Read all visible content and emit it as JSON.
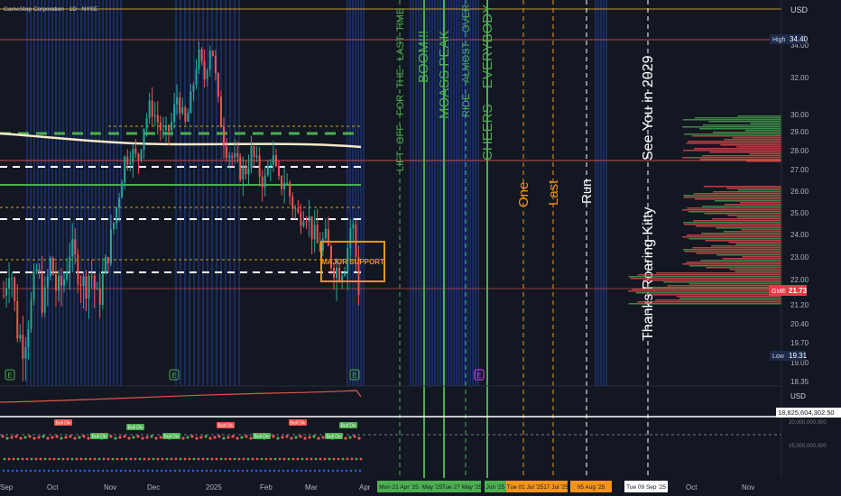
{
  "header": {
    "title": "GameStop Corporation · 1D · NYSE",
    "currency": "USD",
    "sub_currency": "USD",
    "sub_value": "18,825,604,302.50"
  },
  "price_axis": {
    "ticks": [
      "34.00",
      "32.00",
      "30.00",
      "29.00",
      "28.00",
      "27.00",
      "26.00",
      "25.00",
      "24.00",
      "23.00",
      "22.00",
      "21.20",
      "20.40",
      "19.70",
      "19.00",
      "18.35"
    ],
    "high_label": "High",
    "high_value": "34.40",
    "low_label": "Low",
    "low_value": "19.31",
    "ticker_label": "GME",
    "current_value": "21.73",
    "sub_ticks": [
      "20,000,000,000",
      "15,000,000,000"
    ]
  },
  "time_axis": {
    "labels": [
      "Sep",
      "Oct",
      "Nov",
      "Dec",
      "2025",
      "Feb",
      "Mar",
      "Apr",
      "Oct",
      "Nov"
    ],
    "marker_dates": [
      {
        "text": "Mon 21 Apr '25",
        "color": "#4caf50"
      },
      {
        "text": "May '25",
        "color": "#4caf50"
      },
      {
        "text": "Tue 27 May '25",
        "color": "#4caf50"
      },
      {
        "text": "Jun '25",
        "color": "#4caf50"
      },
      {
        "text": "Tue 01 Jul '25",
        "color": "#f7931a"
      },
      {
        "text": "17 Jul '25",
        "color": "#f7931a"
      },
      {
        "text": "05 Aug '25",
        "color": "#f7931a"
      },
      {
        "text": "Tue 09 Sep '25",
        "color": "#ffffff"
      }
    ]
  },
  "annotations": {
    "vertical_green": [
      "LIFT",
      "OFF",
      "FOR",
      "THE",
      "LAST",
      "TIME"
    ],
    "boom": "BOOM!!!",
    "moass": "MOASS PEAK",
    "ride_words": [
      "RIDE",
      "ALMOST",
      "OVER"
    ],
    "cheers": "CHEERS",
    "everybody": "EVERYBODY",
    "orange_words": [
      "One",
      "Last"
    ],
    "white_run": "Run",
    "kitty": "Thanks Roaring Kitty",
    "see_you": "See You in 2029",
    "support_label": "MAJOR SUPPORT",
    "indicator_label": "Bull Div"
  },
  "event_badges": [
    "E",
    "E",
    "E",
    "E"
  ],
  "chart_data": {
    "type": "candlestick",
    "title": "GameStop Corporation · 1D · NYSE",
    "ylim": [
      18.35,
      35.0
    ],
    "high": 34.4,
    "low": 19.31,
    "last": 21.73,
    "x_labels": [
      "Sep",
      "Oct",
      "Nov",
      "Dec",
      "2025",
      "Feb",
      "Mar",
      "Apr"
    ],
    "close_path": [
      21.5,
      22.8,
      20.2,
      19.6,
      21.0,
      22.5,
      21.0,
      22.8,
      21.5,
      22.0,
      23.5,
      22.5,
      21.8,
      22.4,
      21.2,
      22.3,
      23.8,
      25.5,
      27.5,
      28.0,
      27.4,
      29.5,
      30.5,
      29.6,
      28.6,
      29.4,
      31.2,
      29.2,
      30.8,
      33.5,
      32.0,
      34.4,
      30.6,
      28.4,
      27.7,
      27.1,
      26.9,
      27.9,
      27.0,
      26.4,
      27.9,
      26.2,
      26.6,
      25.5,
      24.8,
      25.3,
      24.2,
      23.4,
      23.8,
      22.7,
      22.4,
      22.8,
      24.8,
      21.8
    ]
  }
}
